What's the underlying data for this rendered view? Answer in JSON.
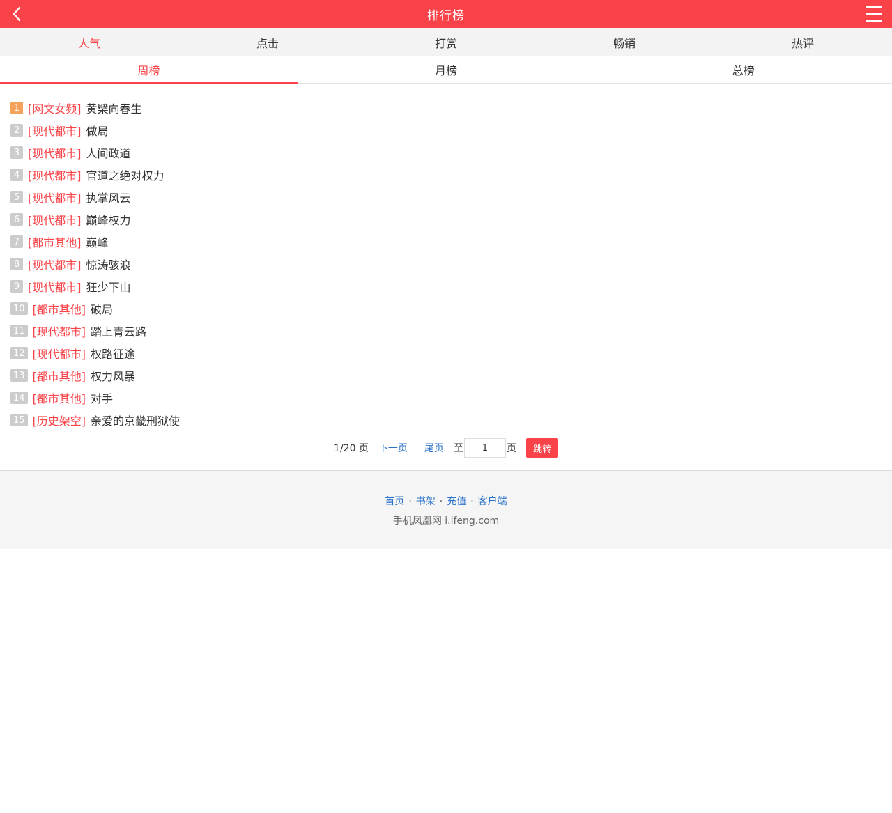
{
  "header": {
    "title": "排行榜",
    "back_icon": "chevron-left-icon",
    "menu_icon": "hamburger-menu-icon",
    "color": "#f94348"
  },
  "category_tabs": [
    "人气",
    "点击",
    "打赏",
    "畅销",
    "热评"
  ],
  "category_active": 0,
  "period_tabs": [
    "周榜",
    "月榜",
    "总榜"
  ],
  "period_active": 0,
  "ranking": [
    {
      "rank": "1",
      "category": "[网文女频]",
      "title": "黄檗向春生"
    },
    {
      "rank": "2",
      "category": "[现代都市]",
      "title": "做局"
    },
    {
      "rank": "3",
      "category": "[现代都市]",
      "title": "人间政道"
    },
    {
      "rank": "4",
      "category": "[现代都市]",
      "title": "官道之绝对权力"
    },
    {
      "rank": "5",
      "category": "[现代都市]",
      "title": "执掌风云"
    },
    {
      "rank": "6",
      "category": "[现代都市]",
      "title": "巅峰权力"
    },
    {
      "rank": "7",
      "category": "[都市其他]",
      "title": "巅峰"
    },
    {
      "rank": "8",
      "category": "[现代都市]",
      "title": "惊涛骇浪"
    },
    {
      "rank": "9",
      "category": "[现代都市]",
      "title": "狂少下山"
    },
    {
      "rank": "10",
      "category": "[都市其他]",
      "title": "破局"
    },
    {
      "rank": "11",
      "category": "[现代都市]",
      "title": "踏上青云路"
    },
    {
      "rank": "12",
      "category": "[现代都市]",
      "title": "权路征途"
    },
    {
      "rank": "13",
      "category": "[都市其他]",
      "title": "权力风暴"
    },
    {
      "rank": "14",
      "category": "[都市其他]",
      "title": "对手"
    },
    {
      "rank": "15",
      "category": "[历史架空]",
      "title": "亲爱的京畿刑狱使"
    }
  ],
  "pager": {
    "info": "1/20 页",
    "next": "下一页",
    "last": "尾页",
    "to_label": "至",
    "page_value": "1",
    "unit": "页",
    "jump": "跳转"
  },
  "footer": {
    "links": [
      "首页",
      "书架",
      "充值",
      "客户端"
    ],
    "separator": "·",
    "copyright": "手机凤凰网 i.ifeng.com"
  }
}
